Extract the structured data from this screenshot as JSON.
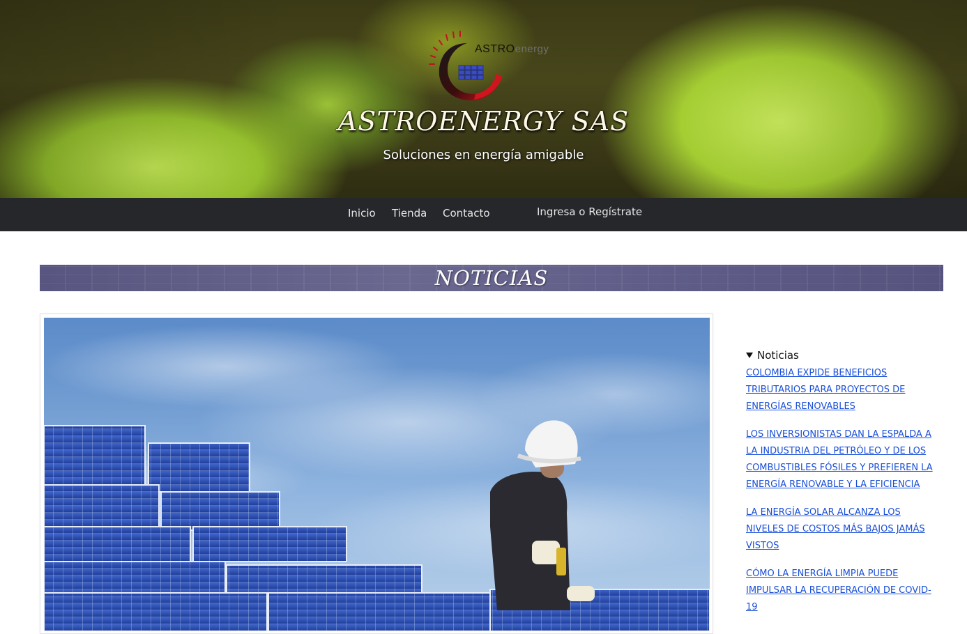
{
  "hero": {
    "logo_text_strong": "ASTRO",
    "logo_text_light": "energy",
    "site_title": "ASTROENERGY SAS",
    "tagline": "Soluciones en energía amigable"
  },
  "nav": {
    "items": [
      {
        "label": "Inicio"
      },
      {
        "label": "Tienda"
      },
      {
        "label": "Contacto"
      }
    ],
    "account_label": "Ingresa o Regístrate"
  },
  "section": {
    "title": "NOTICIAS"
  },
  "sidebar": {
    "widget_title": "Noticias",
    "news": [
      {
        "label": "COLOMBIA EXPIDE BENEFICIOS TRIBUTARIOS PARA PROYECTOS DE ENERGÍAS RENOVABLES"
      },
      {
        "label": "LOS INVERSIONISTAS DAN LA ESPALDA A LA INDUSTRIA DEL PETRÓLEO Y DE LOS COMBUSTIBLES FÓSILES Y PREFIEREN LA ENERGÍA RENOVABLE Y LA EFICIENCIA"
      },
      {
        "label": "LA ENERGÍA SOLAR ALCANZA LOS NIVELES DE COSTOS MÁS BAJOS JAMÁS VISTOS"
      },
      {
        "label": "CÓMO LA ENERGÍA LIMPIA PUEDE IMPULSAR LA RECUPERACIÓN DE COVID-19"
      }
    ]
  },
  "colors": {
    "nav_background": "#25272b",
    "banner_background": "#5f5d88",
    "link": "#1a4fd6",
    "logo_red": "#c0141c"
  }
}
